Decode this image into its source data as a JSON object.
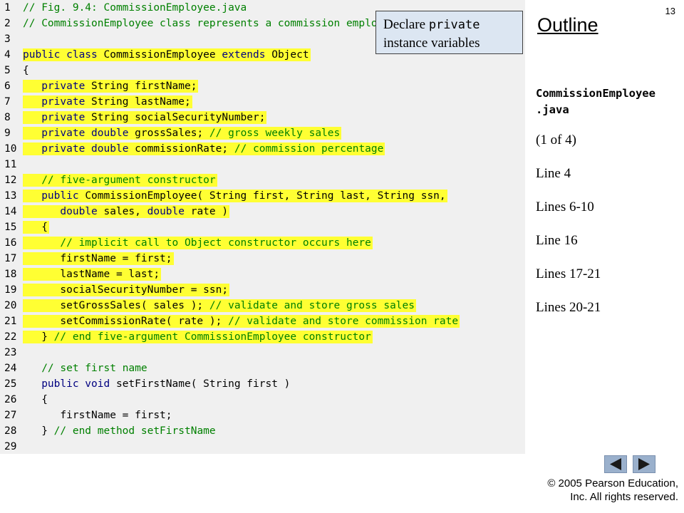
{
  "code_lines": [
    {
      "n": "1",
      "hl": false,
      "segs": [
        {
          "t": "// Fig. 9.4: CommissionEmployee.java",
          "c": "c"
        }
      ]
    },
    {
      "n": "2",
      "hl": false,
      "segs": [
        {
          "t": "// CommissionEmployee class represents a commission employee.",
          "c": "c"
        }
      ]
    },
    {
      "n": "3",
      "hl": false,
      "segs": []
    },
    {
      "n": "4",
      "hl": true,
      "segs": [
        {
          "t": "public class ",
          "c": "k"
        },
        {
          "t": "CommissionEmployee ",
          "c": "t"
        },
        {
          "t": "extends ",
          "c": "k"
        },
        {
          "t": "Object",
          "c": "t"
        }
      ]
    },
    {
      "n": "5",
      "hl": false,
      "segs": [
        {
          "t": "{",
          "c": "t"
        }
      ]
    },
    {
      "n": "6",
      "hl": true,
      "segs": [
        {
          "t": "   ",
          "c": "t"
        },
        {
          "t": "private ",
          "c": "k"
        },
        {
          "t": "String firstName;",
          "c": "t"
        }
      ]
    },
    {
      "n": "7",
      "hl": true,
      "segs": [
        {
          "t": "   ",
          "c": "t"
        },
        {
          "t": "private ",
          "c": "k"
        },
        {
          "t": "String lastName;",
          "c": "t"
        }
      ]
    },
    {
      "n": "8",
      "hl": true,
      "segs": [
        {
          "t": "   ",
          "c": "t"
        },
        {
          "t": "private ",
          "c": "k"
        },
        {
          "t": "String socialSecurityNumber;",
          "c": "t"
        }
      ]
    },
    {
      "n": "9",
      "hl": true,
      "segs": [
        {
          "t": "   ",
          "c": "t"
        },
        {
          "t": "private double ",
          "c": "k"
        },
        {
          "t": "grossSales; ",
          "c": "t"
        },
        {
          "t": "// gross weekly sales",
          "c": "c"
        }
      ]
    },
    {
      "n": "10",
      "hl": true,
      "segs": [
        {
          "t": "   ",
          "c": "t"
        },
        {
          "t": "private double ",
          "c": "k"
        },
        {
          "t": "commissionRate; ",
          "c": "t"
        },
        {
          "t": "// commission percentage",
          "c": "c"
        }
      ]
    },
    {
      "n": "11",
      "hl": false,
      "segs": []
    },
    {
      "n": "12",
      "hl": true,
      "segs": [
        {
          "t": "   ",
          "c": "t"
        },
        {
          "t": "// five-argument constructor",
          "c": "c"
        }
      ]
    },
    {
      "n": "13",
      "hl": true,
      "segs": [
        {
          "t": "   ",
          "c": "t"
        },
        {
          "t": "public ",
          "c": "k"
        },
        {
          "t": "CommissionEmployee( String first, String last, String ssn,",
          "c": "t"
        }
      ]
    },
    {
      "n": "14",
      "hl": true,
      "segs": [
        {
          "t": "      ",
          "c": "t"
        },
        {
          "t": "double ",
          "c": "k"
        },
        {
          "t": "sales, ",
          "c": "t"
        },
        {
          "t": "double ",
          "c": "k"
        },
        {
          "t": "rate )",
          "c": "t"
        }
      ]
    },
    {
      "n": "15",
      "hl": true,
      "segs": [
        {
          "t": "   {",
          "c": "t"
        }
      ]
    },
    {
      "n": "16",
      "hl": true,
      "segs": [
        {
          "t": "      ",
          "c": "t"
        },
        {
          "t": "// implicit call to Object constructor occurs here",
          "c": "c"
        }
      ]
    },
    {
      "n": "17",
      "hl": true,
      "segs": [
        {
          "t": "      firstName = first;",
          "c": "t"
        }
      ]
    },
    {
      "n": "18",
      "hl": true,
      "segs": [
        {
          "t": "      lastName = last;",
          "c": "t"
        }
      ]
    },
    {
      "n": "19",
      "hl": true,
      "segs": [
        {
          "t": "      socialSecurityNumber = ssn;",
          "c": "t"
        }
      ]
    },
    {
      "n": "20",
      "hl": true,
      "segs": [
        {
          "t": "      setGrossSales( sales ); ",
          "c": "t"
        },
        {
          "t": "// validate and store gross sales",
          "c": "c"
        }
      ]
    },
    {
      "n": "21",
      "hl": true,
      "segs": [
        {
          "t": "      setCommissionRate( rate ); ",
          "c": "t"
        },
        {
          "t": "// validate and store commission rate",
          "c": "c"
        }
      ]
    },
    {
      "n": "22",
      "hl": true,
      "segs": [
        {
          "t": "   } ",
          "c": "t"
        },
        {
          "t": "// end five-argument CommissionEmployee constructor",
          "c": "c"
        }
      ]
    },
    {
      "n": "23",
      "hl": false,
      "segs": []
    },
    {
      "n": "24",
      "hl": false,
      "segs": [
        {
          "t": "   ",
          "c": "t"
        },
        {
          "t": "// set first name",
          "c": "c"
        }
      ]
    },
    {
      "n": "25",
      "hl": false,
      "segs": [
        {
          "t": "   ",
          "c": "t"
        },
        {
          "t": "public void ",
          "c": "k"
        },
        {
          "t": "setFirstName( String first )",
          "c": "t"
        }
      ]
    },
    {
      "n": "26",
      "hl": false,
      "segs": [
        {
          "t": "   {",
          "c": "t"
        }
      ]
    },
    {
      "n": "27",
      "hl": false,
      "segs": [
        {
          "t": "      firstName = first;",
          "c": "t"
        }
      ]
    },
    {
      "n": "28",
      "hl": false,
      "segs": [
        {
          "t": "   } ",
          "c": "t"
        },
        {
          "t": "// end method setFirstName",
          "c": "c"
        }
      ]
    },
    {
      "n": "29",
      "hl": false,
      "segs": []
    }
  ],
  "callout": {
    "prefix": "Declare ",
    "keyword": "private",
    "suffix": "instance variables"
  },
  "slide_number": "13",
  "outline": {
    "title": "Outline",
    "file_name": "CommissionEmployee\n.java",
    "notes": [
      "(1 of 4)",
      "Line 4",
      "Lines 6-10",
      "Line 16",
      "Lines 17-21",
      "Lines 20-21"
    ]
  },
  "nav": {
    "prev_icon": "triangle-left-icon",
    "next_icon": "triangle-right-icon"
  },
  "copyright": {
    "line1": "© 2005 Pearson Education,",
    "line2": "Inc.  All rights reserved."
  },
  "colors": {
    "highlight": "#ffff33",
    "keyword": "#000080",
    "comment": "#008000",
    "code_bg": "#f0f0f0",
    "nav_button": "#9ab0cc"
  }
}
